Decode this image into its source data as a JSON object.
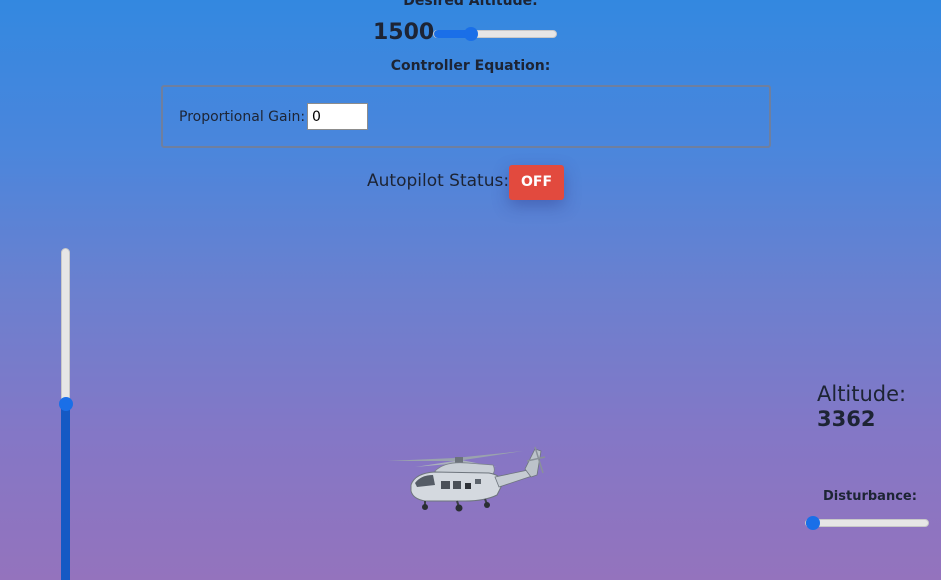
{
  "desired_altitude": {
    "label": "Desired Altitude:",
    "value": "1500",
    "slider_fraction": 0.3
  },
  "controller": {
    "title": "Controller Equation:",
    "gain_label": "Proportional Gain:",
    "gain_value": "0"
  },
  "autopilot": {
    "label": "Autopilot Status:",
    "button_label": "OFF",
    "button_color": "#e24a3e"
  },
  "altitude": {
    "label": "Altitude:",
    "value": "3362",
    "slider_fraction": 0.54
  },
  "disturbance": {
    "label": "Disturbance:",
    "slider_fraction": 0.06
  },
  "colors": {
    "accent": "#1a6fe8",
    "background_top": "#3388e0",
    "background_bottom": "#9473bd"
  },
  "icons": {
    "aircraft": "helicopter-icon"
  }
}
